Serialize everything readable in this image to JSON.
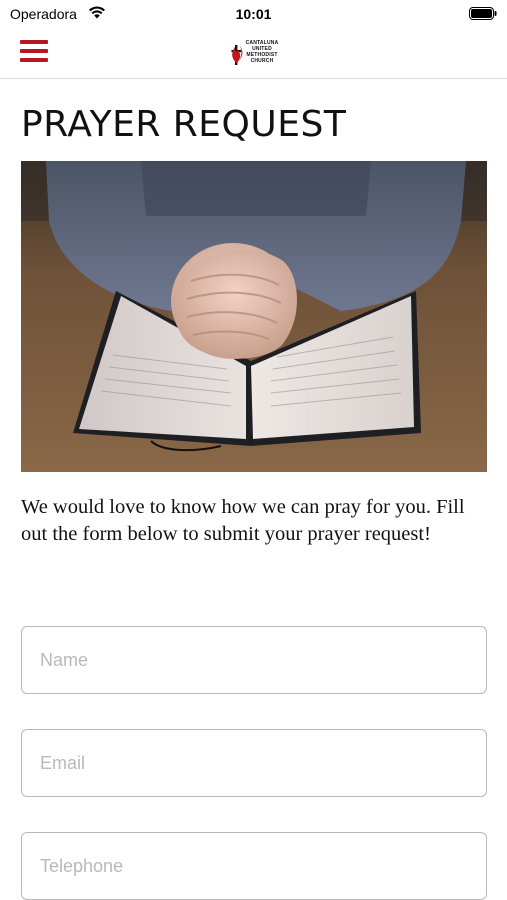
{
  "status_bar": {
    "carrier": "Operadora",
    "time": "10:01",
    "wifi_icon": "wifi-icon",
    "battery_icon": "battery-icon",
    "battery_level": 0.9
  },
  "nav": {
    "menu_icon": "hamburger-menu-icon",
    "logo_lines": [
      "CANTALUNA",
      "UNITED",
      "METHODIST",
      "CHURCH"
    ],
    "accent_color": "#b5191f"
  },
  "page": {
    "title": "PRAYER REQUEST",
    "intro": "We would love to know how we can pray for you. Fill out the form below to submit your prayer request!"
  },
  "form": {
    "name_placeholder": "Name",
    "email_placeholder": "Email",
    "telephone_placeholder": "Telephone"
  }
}
